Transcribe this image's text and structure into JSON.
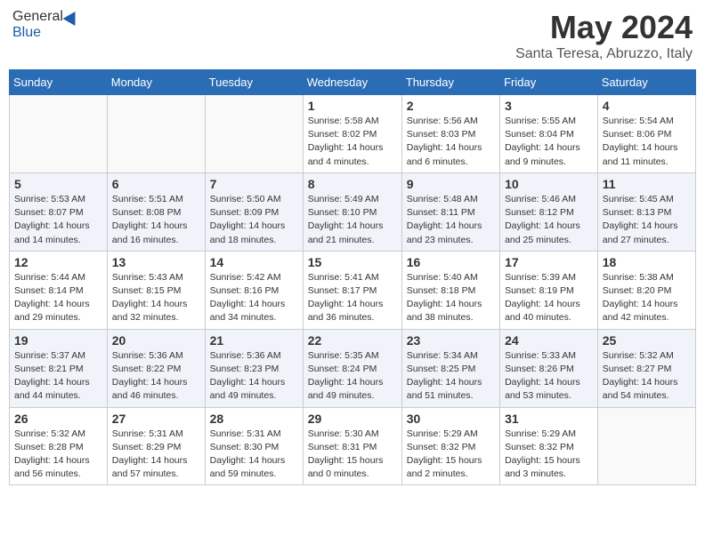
{
  "header": {
    "logo_general": "General",
    "logo_blue": "Blue",
    "month_year": "May 2024",
    "location": "Santa Teresa, Abruzzo, Italy"
  },
  "weekdays": [
    "Sunday",
    "Monday",
    "Tuesday",
    "Wednesday",
    "Thursday",
    "Friday",
    "Saturday"
  ],
  "weeks": [
    [
      {
        "day": "",
        "sunrise": "",
        "sunset": "",
        "daylight": ""
      },
      {
        "day": "",
        "sunrise": "",
        "sunset": "",
        "daylight": ""
      },
      {
        "day": "",
        "sunrise": "",
        "sunset": "",
        "daylight": ""
      },
      {
        "day": "1",
        "sunrise": "Sunrise: 5:58 AM",
        "sunset": "Sunset: 8:02 PM",
        "daylight": "Daylight: 14 hours and 4 minutes."
      },
      {
        "day": "2",
        "sunrise": "Sunrise: 5:56 AM",
        "sunset": "Sunset: 8:03 PM",
        "daylight": "Daylight: 14 hours and 6 minutes."
      },
      {
        "day": "3",
        "sunrise": "Sunrise: 5:55 AM",
        "sunset": "Sunset: 8:04 PM",
        "daylight": "Daylight: 14 hours and 9 minutes."
      },
      {
        "day": "4",
        "sunrise": "Sunrise: 5:54 AM",
        "sunset": "Sunset: 8:06 PM",
        "daylight": "Daylight: 14 hours and 11 minutes."
      }
    ],
    [
      {
        "day": "5",
        "sunrise": "Sunrise: 5:53 AM",
        "sunset": "Sunset: 8:07 PM",
        "daylight": "Daylight: 14 hours and 14 minutes."
      },
      {
        "day": "6",
        "sunrise": "Sunrise: 5:51 AM",
        "sunset": "Sunset: 8:08 PM",
        "daylight": "Daylight: 14 hours and 16 minutes."
      },
      {
        "day": "7",
        "sunrise": "Sunrise: 5:50 AM",
        "sunset": "Sunset: 8:09 PM",
        "daylight": "Daylight: 14 hours and 18 minutes."
      },
      {
        "day": "8",
        "sunrise": "Sunrise: 5:49 AM",
        "sunset": "Sunset: 8:10 PM",
        "daylight": "Daylight: 14 hours and 21 minutes."
      },
      {
        "day": "9",
        "sunrise": "Sunrise: 5:48 AM",
        "sunset": "Sunset: 8:11 PM",
        "daylight": "Daylight: 14 hours and 23 minutes."
      },
      {
        "day": "10",
        "sunrise": "Sunrise: 5:46 AM",
        "sunset": "Sunset: 8:12 PM",
        "daylight": "Daylight: 14 hours and 25 minutes."
      },
      {
        "day": "11",
        "sunrise": "Sunrise: 5:45 AM",
        "sunset": "Sunset: 8:13 PM",
        "daylight": "Daylight: 14 hours and 27 minutes."
      }
    ],
    [
      {
        "day": "12",
        "sunrise": "Sunrise: 5:44 AM",
        "sunset": "Sunset: 8:14 PM",
        "daylight": "Daylight: 14 hours and 29 minutes."
      },
      {
        "day": "13",
        "sunrise": "Sunrise: 5:43 AM",
        "sunset": "Sunset: 8:15 PM",
        "daylight": "Daylight: 14 hours and 32 minutes."
      },
      {
        "day": "14",
        "sunrise": "Sunrise: 5:42 AM",
        "sunset": "Sunset: 8:16 PM",
        "daylight": "Daylight: 14 hours and 34 minutes."
      },
      {
        "day": "15",
        "sunrise": "Sunrise: 5:41 AM",
        "sunset": "Sunset: 8:17 PM",
        "daylight": "Daylight: 14 hours and 36 minutes."
      },
      {
        "day": "16",
        "sunrise": "Sunrise: 5:40 AM",
        "sunset": "Sunset: 8:18 PM",
        "daylight": "Daylight: 14 hours and 38 minutes."
      },
      {
        "day": "17",
        "sunrise": "Sunrise: 5:39 AM",
        "sunset": "Sunset: 8:19 PM",
        "daylight": "Daylight: 14 hours and 40 minutes."
      },
      {
        "day": "18",
        "sunrise": "Sunrise: 5:38 AM",
        "sunset": "Sunset: 8:20 PM",
        "daylight": "Daylight: 14 hours and 42 minutes."
      }
    ],
    [
      {
        "day": "19",
        "sunrise": "Sunrise: 5:37 AM",
        "sunset": "Sunset: 8:21 PM",
        "daylight": "Daylight: 14 hours and 44 minutes."
      },
      {
        "day": "20",
        "sunrise": "Sunrise: 5:36 AM",
        "sunset": "Sunset: 8:22 PM",
        "daylight": "Daylight: 14 hours and 46 minutes."
      },
      {
        "day": "21",
        "sunrise": "Sunrise: 5:36 AM",
        "sunset": "Sunset: 8:23 PM",
        "daylight": "Daylight: 14 hours and 49 minutes."
      },
      {
        "day": "22",
        "sunrise": "Sunrise: 5:35 AM",
        "sunset": "Sunset: 8:24 PM",
        "daylight": "Daylight: 14 hours and 49 minutes."
      },
      {
        "day": "23",
        "sunrise": "Sunrise: 5:34 AM",
        "sunset": "Sunset: 8:25 PM",
        "daylight": "Daylight: 14 hours and 51 minutes."
      },
      {
        "day": "24",
        "sunrise": "Sunrise: 5:33 AM",
        "sunset": "Sunset: 8:26 PM",
        "daylight": "Daylight: 14 hours and 53 minutes."
      },
      {
        "day": "25",
        "sunrise": "Sunrise: 5:32 AM",
        "sunset": "Sunset: 8:27 PM",
        "daylight": "Daylight: 14 hours and 54 minutes."
      }
    ],
    [
      {
        "day": "26",
        "sunrise": "Sunrise: 5:32 AM",
        "sunset": "Sunset: 8:28 PM",
        "daylight": "Daylight: 14 hours and 56 minutes."
      },
      {
        "day": "27",
        "sunrise": "Sunrise: 5:31 AM",
        "sunset": "Sunset: 8:29 PM",
        "daylight": "Daylight: 14 hours and 57 minutes."
      },
      {
        "day": "28",
        "sunrise": "Sunrise: 5:31 AM",
        "sunset": "Sunset: 8:30 PM",
        "daylight": "Daylight: 14 hours and 59 minutes."
      },
      {
        "day": "29",
        "sunrise": "Sunrise: 5:30 AM",
        "sunset": "Sunset: 8:31 PM",
        "daylight": "Daylight: 15 hours and 0 minutes."
      },
      {
        "day": "30",
        "sunrise": "Sunrise: 5:29 AM",
        "sunset": "Sunset: 8:32 PM",
        "daylight": "Daylight: 15 hours and 2 minutes."
      },
      {
        "day": "31",
        "sunrise": "Sunrise: 5:29 AM",
        "sunset": "Sunset: 8:32 PM",
        "daylight": "Daylight: 15 hours and 3 minutes."
      },
      {
        "day": "",
        "sunrise": "",
        "sunset": "",
        "daylight": ""
      }
    ]
  ]
}
